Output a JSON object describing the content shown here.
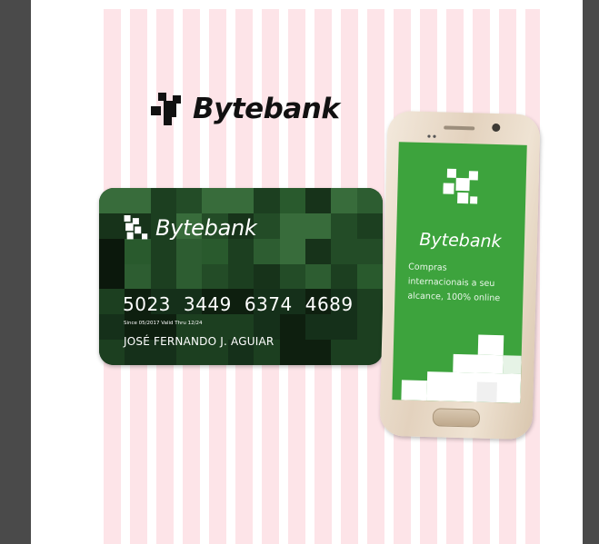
{
  "brand": {
    "name": "Bytebank"
  },
  "card": {
    "number_groups": [
      "5023",
      "3449",
      "6374",
      "4689"
    ],
    "dates": "Since 05/2017  Valid Thru 12/24",
    "holder": "JOSÉ FERNANDO J. AGUIAR"
  },
  "phone": {
    "brand": "Bytebank",
    "tagline": "Compras internacionais a seu alcance, 100% online"
  },
  "colors": {
    "brand_green": "#3da33d",
    "card_dark": "#0f2010",
    "stripe_pink": "#fde4e8",
    "frame": "#4a4a4a"
  },
  "icons": {
    "logo": "bytebank-pixel-logo-icon"
  }
}
